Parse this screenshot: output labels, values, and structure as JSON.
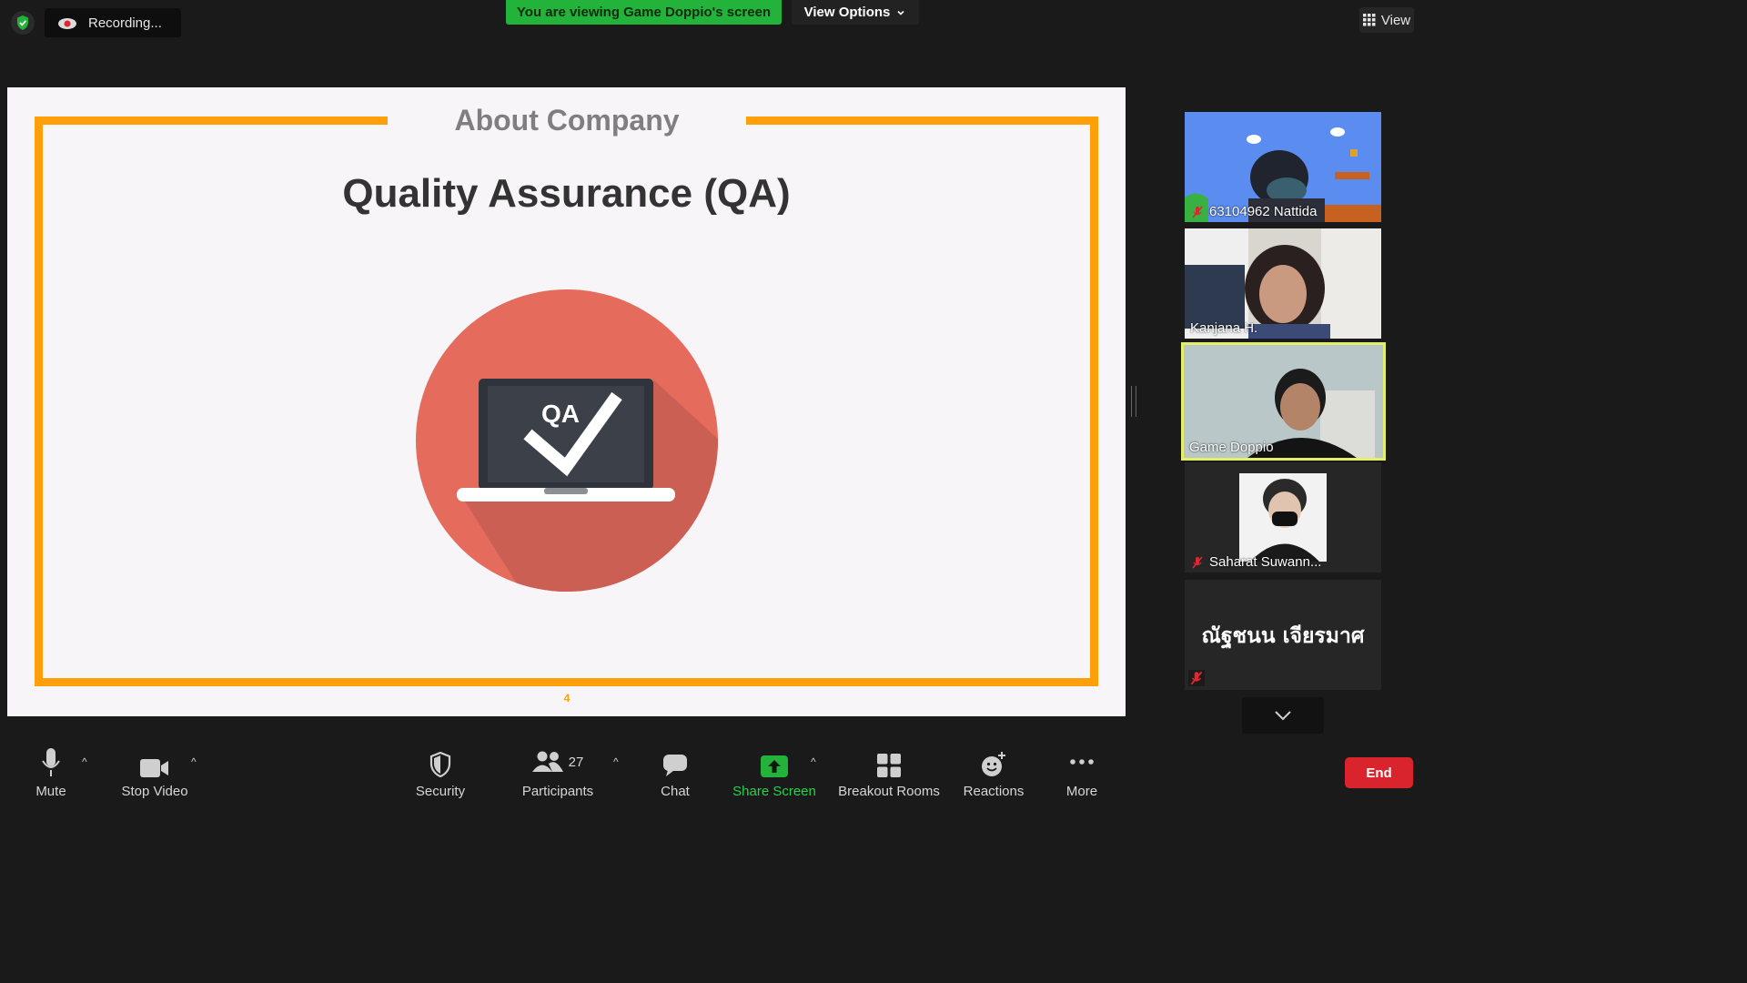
{
  "topbar": {
    "recording": "Recording...",
    "viewing_banner": "You are viewing Game Doppio's screen",
    "view_options": "View Options",
    "view_label": "View"
  },
  "slide": {
    "heading": "About Company",
    "title": "Quality Assurance (QA)",
    "laptop_text": "QA",
    "page_number": "4"
  },
  "participants": [
    {
      "name": "63104962 Nattida",
      "muted": true
    },
    {
      "name": "Kanjana H.",
      "muted": false
    },
    {
      "name": "Game Doppio",
      "muted": false,
      "active": true
    },
    {
      "name": "Saharat Suwann...",
      "muted": true
    },
    {
      "name": "ณัฐชนน เจียรมาศ",
      "muted": true
    }
  ],
  "toolbar": {
    "mute": "Mute",
    "stop_video": "Stop Video",
    "security": "Security",
    "participants": "Participants",
    "participants_count": "27",
    "chat": "Chat",
    "share_screen": "Share Screen",
    "breakout_rooms": "Breakout Rooms",
    "reactions": "Reactions",
    "more": "More",
    "end": "End"
  },
  "colors": {
    "accent_orange": "#ff9f0a",
    "share_green": "#23b33b",
    "end_red": "#d9232d",
    "active_speaker": "#e3ef6a"
  }
}
